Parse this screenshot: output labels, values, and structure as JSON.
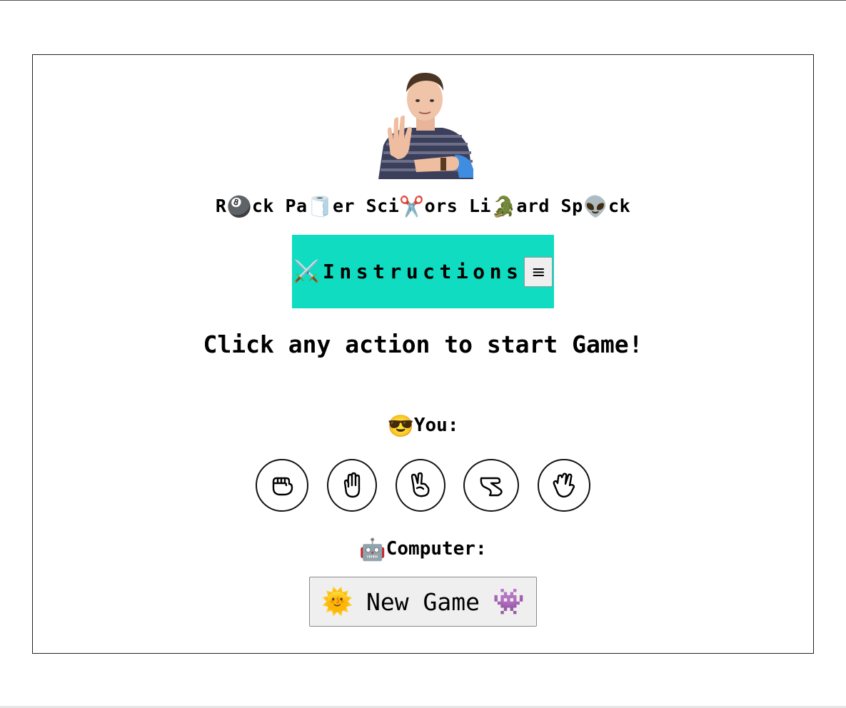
{
  "title": {
    "parts": [
      {
        "text": "R"
      },
      {
        "emoji": "🎱",
        "icon": "8-ball-icon"
      },
      {
        "text": "ck Pa"
      },
      {
        "emoji": "🧻",
        "icon": "toilet-paper-icon"
      },
      {
        "text": "er Sci"
      },
      {
        "emoji": "✂️",
        "icon": "scissors-icon"
      },
      {
        "text": "ors Li"
      },
      {
        "emoji": "🐊",
        "icon": "crocodile-icon"
      },
      {
        "text": "ard Sp"
      },
      {
        "emoji": "👽",
        "icon": "alien-icon"
      },
      {
        "text": "ck"
      }
    ]
  },
  "instructions": {
    "icon": "⚔️",
    "label": "Instructions",
    "menu_icon": "≡",
    "background": "#0fdcc1"
  },
  "prompt": "Click any action to start Game!",
  "player": {
    "icon": "😎",
    "label": "You:",
    "actions": [
      {
        "name": "rock",
        "icon": "hand-fist-icon"
      },
      {
        "name": "paper",
        "icon": "hand-open-icon"
      },
      {
        "name": "scissors",
        "icon": "hand-scissors-icon"
      },
      {
        "name": "lizard",
        "icon": "hand-lizard-icon"
      },
      {
        "name": "spock",
        "icon": "hand-spock-icon"
      }
    ]
  },
  "computer": {
    "icon": "🤖",
    "label": "Computer:"
  },
  "new_game": {
    "left_icon": "🌞",
    "label": "New Game",
    "right_icon": "👾"
  }
}
